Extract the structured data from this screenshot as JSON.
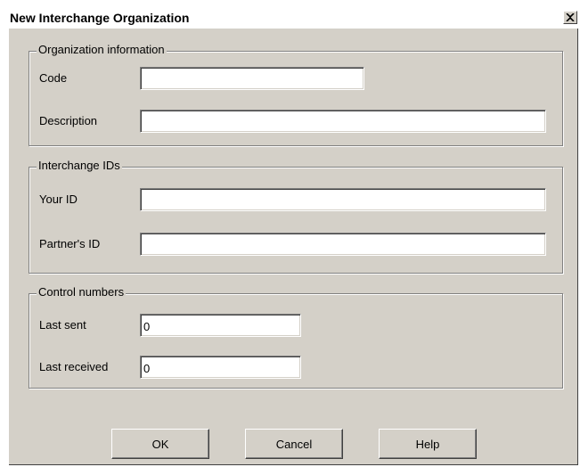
{
  "dialog": {
    "title": "New Interchange Organization",
    "close_icon": "close-icon"
  },
  "org_info": {
    "legend": "Organization information",
    "code_label": "Code",
    "code_value": "",
    "description_label": "Description",
    "description_value": ""
  },
  "interchange_ids": {
    "legend": "Interchange IDs",
    "your_id_label": "Your ID",
    "your_id_value": "",
    "partner_id_label": "Partner's ID",
    "partner_id_value": ""
  },
  "control_numbers": {
    "legend": "Control numbers",
    "last_sent_label": "Last sent",
    "last_sent_value": "0",
    "last_received_label": "Last received",
    "last_received_value": "0"
  },
  "buttons": {
    "ok_label": "OK",
    "cancel_label": "Cancel",
    "help_label": "Help"
  },
  "colors": {
    "dialog_face": "#d4d0c8",
    "title_bar": "#ffffff",
    "field_background": "#ffffff"
  }
}
